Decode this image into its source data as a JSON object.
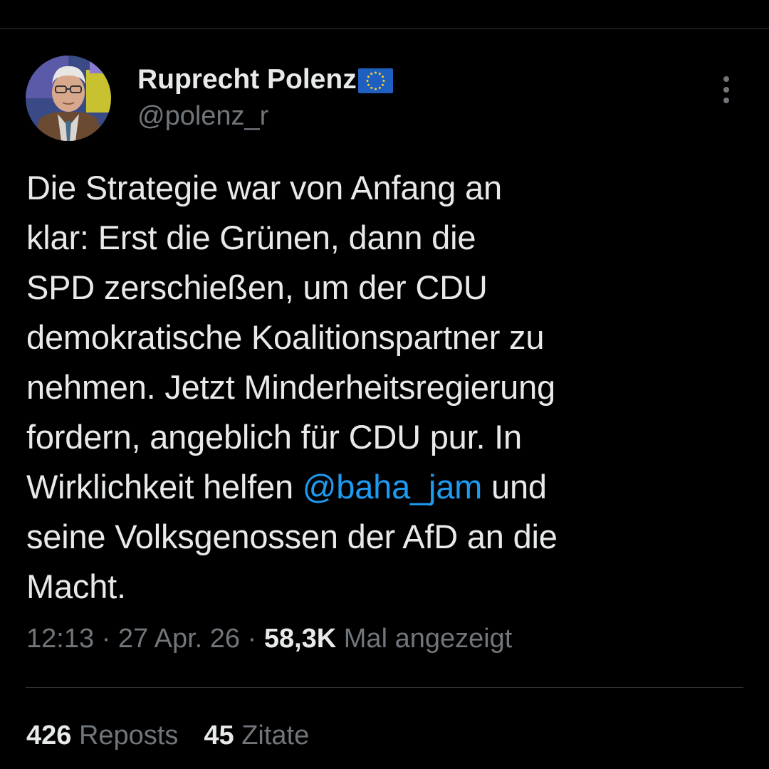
{
  "author": {
    "display_name": "Ruprecht Polenz",
    "badge_icon": "eu-flag-icon",
    "handle": "@polenz_r"
  },
  "menu": {
    "icon": "more-vertical-icon"
  },
  "tweet": {
    "lines": [
      "Die Strategie war von Anfang an",
      "klar: Erst die Grünen, dann die",
      "SPD zerschießen, um der CDU",
      "demokratische Koalitionspartner zu",
      "nehmen. Jetzt Minderheitsregierung",
      "fordern, angeblich für CDU pur. In"
    ],
    "line7_before": "Wirklichkeit helfen ",
    "mention": "@baha_jam",
    "line7_after": " und",
    "line8": "seine Volksgenossen der AfD an die",
    "line9": "Macht."
  },
  "meta": {
    "time": "12:13",
    "sep1": " · ",
    "date": "27 Apr. 26",
    "sep2": " · ",
    "views": "58,3K",
    "views_label": " Mal angezeigt"
  },
  "stats": {
    "reposts_count": "426",
    "reposts_label": " Reposts",
    "quotes_count": "45",
    "quotes_label": " Zitate"
  },
  "colors": {
    "background": "#000000",
    "text": "#e7e9ea",
    "muted": "#71767b",
    "link": "#1d9bf0",
    "divider": "#2f3336"
  }
}
